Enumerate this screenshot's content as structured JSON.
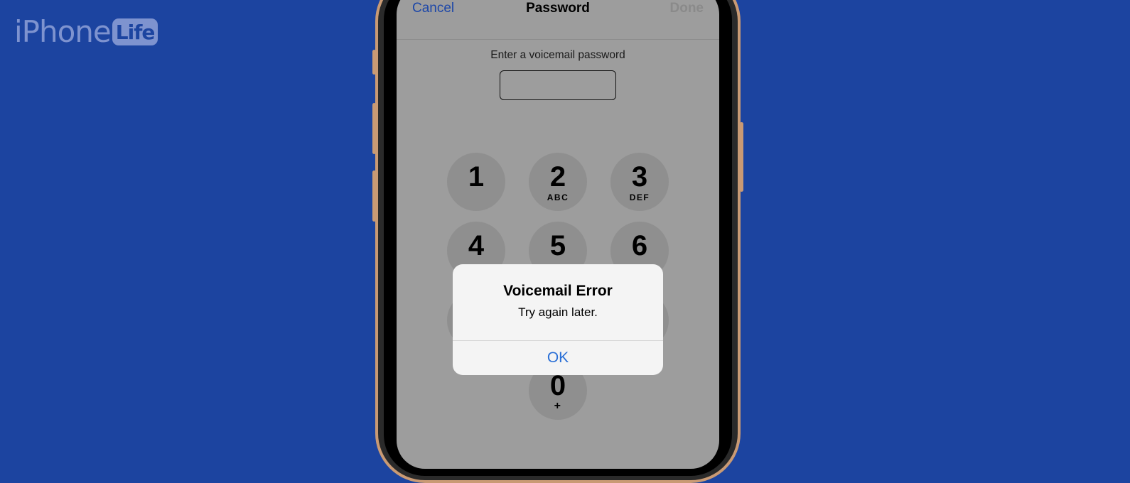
{
  "watermark": {
    "brand_main": "iPhone",
    "brand_badge": "Life"
  },
  "nav": {
    "cancel_label": "Cancel",
    "title": "Password",
    "done_label": "Done"
  },
  "form": {
    "prompt": "Enter a voicemail password",
    "password_value": ""
  },
  "keypad": {
    "keys": [
      {
        "digit": "1",
        "letters": ""
      },
      {
        "digit": "2",
        "letters": "ABC"
      },
      {
        "digit": "3",
        "letters": "DEF"
      },
      {
        "digit": "4",
        "letters": ""
      },
      {
        "digit": "5",
        "letters": ""
      },
      {
        "digit": "6",
        "letters": ""
      },
      {
        "digit": "",
        "letters": ""
      },
      {
        "digit": "",
        "letters": ""
      },
      {
        "digit": "",
        "letters": ""
      },
      {
        "digit": "0",
        "letters": "+"
      }
    ]
  },
  "alert": {
    "title": "Voicemail Error",
    "message": "Try again later.",
    "ok_label": "OK"
  },
  "colors": {
    "background": "#1c44a0",
    "link_blue": "#1d47a8",
    "alert_button": "#2a6fd6",
    "dimmed_screen": "#9d9d9d"
  }
}
